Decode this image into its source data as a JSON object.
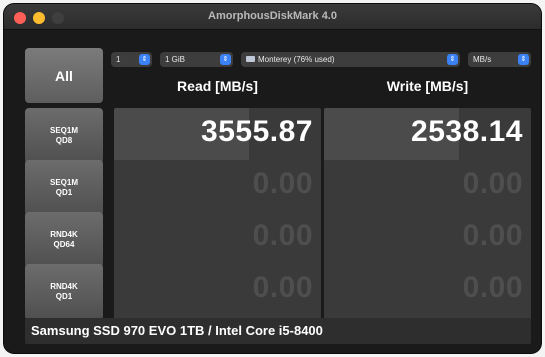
{
  "window": {
    "title": "AmorphousDiskMark 4.0"
  },
  "controls": {
    "run_all_label": "All",
    "count": "1",
    "size": "1 GiB",
    "drive": "Monterey (76% used)",
    "unit": "MB/s"
  },
  "columns": {
    "read": "Read [MB/s]",
    "write": "Write [MB/s]"
  },
  "tests": [
    {
      "line1": "SEQ1M",
      "line2": "QD8",
      "read": "3555.87",
      "write": "2538.14",
      "read_fill": 0.65,
      "write_fill": 0.65
    },
    {
      "line1": "SEQ1M",
      "line2": "QD1",
      "read": "0.00",
      "write": "0.00",
      "read_fill": 0,
      "write_fill": 0
    },
    {
      "line1": "RND4K",
      "line2": "QD64",
      "read": "0.00",
      "write": "0.00",
      "read_fill": 0,
      "write_fill": 0
    },
    {
      "line1": "RND4K",
      "line2": "QD1",
      "read": "0.00",
      "write": "0.00",
      "read_fill": 0,
      "write_fill": 0
    }
  ],
  "footer": {
    "system_info": "Samsung SSD 970 EVO 1TB / Intel Core i5-8400"
  },
  "colors": {
    "close": "#fe5f57",
    "minimize": "#febc2e",
    "select_accent": "#3b82f6",
    "background": "#1a1a1a"
  }
}
